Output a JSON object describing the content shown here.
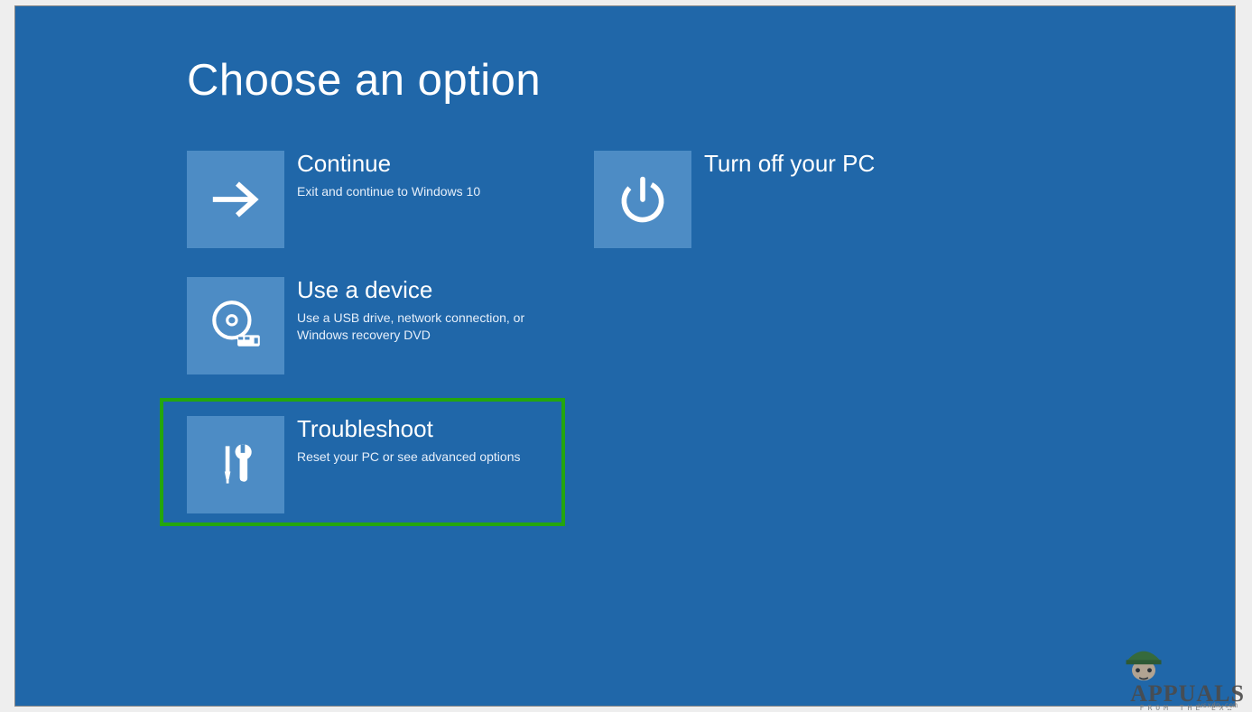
{
  "header": {
    "title": "Choose an option"
  },
  "options": {
    "continue": {
      "title": "Continue",
      "description": "Exit and continue to Windows 10"
    },
    "use_device": {
      "title": "Use a device",
      "description": "Use a USB drive, network connection, or Windows recovery DVD"
    },
    "troubleshoot": {
      "title": "Troubleshoot",
      "description": "Reset your PC or see advanced options"
    },
    "turn_off": {
      "title": "Turn off your PC",
      "description": ""
    }
  },
  "watermark": {
    "main": "APPUALS",
    "subtitle": "FROM THE EX…",
    "tiny": "wsxdn.com"
  }
}
